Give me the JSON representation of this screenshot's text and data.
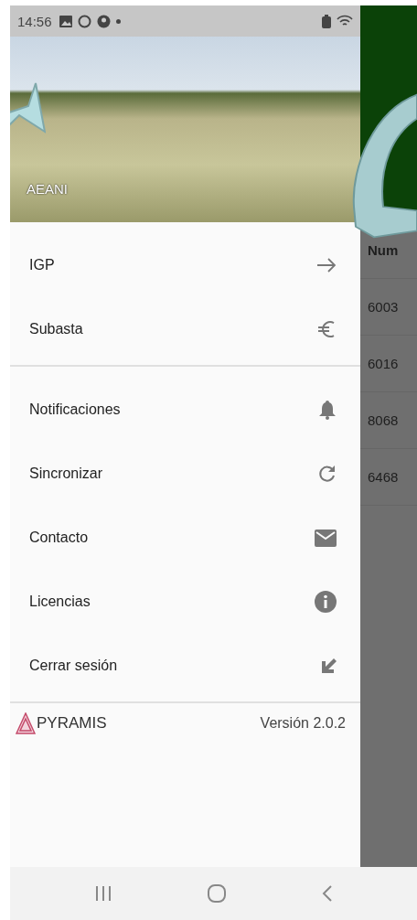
{
  "status_bar": {
    "time": "14:56"
  },
  "drawer": {
    "header": {
      "title": "AEANI"
    },
    "sections": [
      {
        "items": [
          {
            "label": "IGP",
            "kind": "arrow"
          },
          {
            "label": "Subasta",
            "kind": "euro"
          }
        ]
      },
      {
        "items": [
          {
            "label": "Notificaciones",
            "kind": "bell"
          },
          {
            "label": "Sincronizar",
            "kind": "refresh"
          },
          {
            "label": "Contacto",
            "kind": "mail"
          },
          {
            "label": "Licencias",
            "kind": "info"
          },
          {
            "label": "Cerrar sesión",
            "kind": "exit"
          }
        ]
      }
    ],
    "footer": {
      "logo": "PYRAMIS",
      "version": "Versión 2.0.2"
    }
  },
  "background_table": {
    "columns": [
      "Num"
    ],
    "rows": [
      "6003",
      "6016",
      "8068",
      "6468"
    ]
  }
}
